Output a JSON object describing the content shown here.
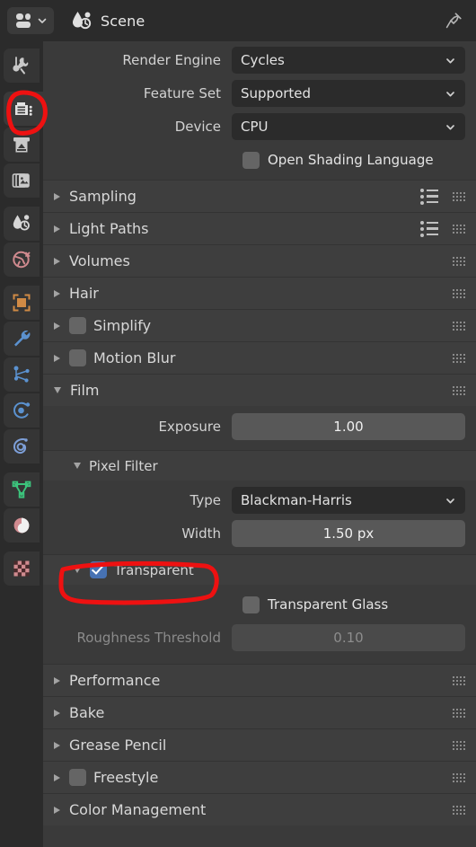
{
  "header": {
    "editor_type_icon": "properties-editor-icon",
    "scene_icon": "scene-data-icon",
    "title": "Scene",
    "pin_icon": "pin-icon",
    "chevron_icon": "chevron-down-icon"
  },
  "tabs": [
    {
      "name": "tool",
      "icon": "tool-icon",
      "active": false
    },
    {
      "name": "render",
      "icon": "render-camera-back-icon",
      "active": true
    },
    {
      "name": "output",
      "icon": "output-printer-icon",
      "active": false
    },
    {
      "name": "view-layer",
      "icon": "view-layer-images-icon",
      "active": false
    },
    {
      "name": "scene",
      "icon": "scene-cone-icon",
      "active": false
    },
    {
      "name": "world",
      "icon": "world-globe-icon",
      "active": false
    },
    {
      "name": "object",
      "icon": "object-square-icon",
      "active": false
    },
    {
      "name": "modifiers",
      "icon": "wrench-icon",
      "active": false
    },
    {
      "name": "particles",
      "icon": "particles-icon",
      "active": false
    },
    {
      "name": "physics",
      "icon": "physics-orbit-icon",
      "active": false
    },
    {
      "name": "object-constraints",
      "icon": "constraints-icon",
      "active": false
    },
    {
      "name": "object-data",
      "icon": "mesh-data-triangle-icon",
      "active": false
    },
    {
      "name": "material",
      "icon": "material-sphere-icon",
      "active": false
    },
    {
      "name": "texture",
      "icon": "texture-checker-icon",
      "active": false
    }
  ],
  "render_settings": {
    "engine": {
      "label": "Render Engine",
      "value": "Cycles"
    },
    "feature_set": {
      "label": "Feature Set",
      "value": "Supported"
    },
    "device": {
      "label": "Device",
      "value": "CPU"
    },
    "osl": {
      "label": "Open Shading Language",
      "checked": false
    }
  },
  "panels": [
    {
      "name": "sampling",
      "label": "Sampling",
      "open": false,
      "checkbox": null,
      "presets": true,
      "grip": true
    },
    {
      "name": "light-paths",
      "label": "Light Paths",
      "open": false,
      "checkbox": null,
      "presets": true,
      "grip": true
    },
    {
      "name": "volumes",
      "label": "Volumes",
      "open": false,
      "checkbox": null,
      "presets": false,
      "grip": true
    },
    {
      "name": "hair",
      "label": "Hair",
      "open": false,
      "checkbox": null,
      "presets": false,
      "grip": true
    },
    {
      "name": "simplify",
      "label": "Simplify",
      "open": false,
      "checkbox": false,
      "presets": false,
      "grip": true
    },
    {
      "name": "motion-blur",
      "label": "Motion Blur",
      "open": false,
      "checkbox": false,
      "presets": false,
      "grip": true
    },
    {
      "name": "film",
      "label": "Film",
      "open": true,
      "checkbox": null,
      "presets": false,
      "grip": true
    }
  ],
  "film": {
    "exposure": {
      "label": "Exposure",
      "value": "1.00"
    },
    "pixel_filter": {
      "label": "Pixel Filter",
      "open": true,
      "type": {
        "label": "Type",
        "value": "Blackman-Harris"
      },
      "width": {
        "label": "Width",
        "value": "1.50 px"
      }
    },
    "transparent": {
      "label": "Transparent",
      "open": true,
      "checked": true,
      "transparent_glass": {
        "label": "Transparent Glass",
        "checked": false
      },
      "roughness_threshold": {
        "label": "Roughness Threshold",
        "value": "0.10",
        "disabled": true
      }
    }
  },
  "panels_bottom": [
    {
      "name": "performance",
      "label": "Performance",
      "open": false,
      "checkbox": null,
      "grip": true
    },
    {
      "name": "bake",
      "label": "Bake",
      "open": false,
      "checkbox": null,
      "grip": true
    },
    {
      "name": "grease-pencil",
      "label": "Grease Pencil",
      "open": false,
      "checkbox": null,
      "grip": true
    },
    {
      "name": "freestyle",
      "label": "Freestyle",
      "open": false,
      "checkbox": false,
      "grip": true
    },
    {
      "name": "color-management",
      "label": "Color Management",
      "open": false,
      "checkbox": null,
      "grip": true
    }
  ],
  "annotation": {
    "color": "#ee1111",
    "shapes": [
      "ellipse-around-render-tab",
      "ellipse-around-transparent-checkbox"
    ]
  },
  "colors": {
    "window_bg": "#303030",
    "header_bg": "#2b2b2b",
    "panel_bg": "#3a3a3a",
    "panel_header_bg": "#3e3e3e",
    "dropdown_bg": "#2b2b2b",
    "value_field_bg": "#585858",
    "checkbox_on": "#4772b3",
    "text": "#e6e6e6"
  }
}
